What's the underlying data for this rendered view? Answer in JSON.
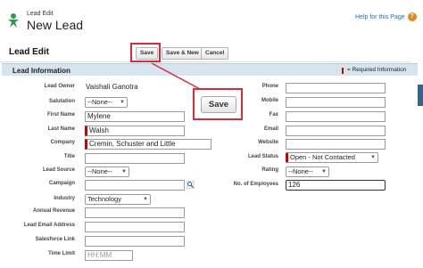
{
  "header": {
    "subtitle": "Lead Edit",
    "title": "New Lead",
    "help_link": "Help for this Page"
  },
  "edit_bar": {
    "title": "Lead Edit",
    "save": "Save",
    "save_new": "Save & New",
    "cancel": "Cancel"
  },
  "section": {
    "title": "Lead Information",
    "required_legend": "= Required Information"
  },
  "left_fields": {
    "lead_owner": {
      "label": "Lead Owner",
      "value": "Vaishali Ganotra"
    },
    "salutation": {
      "label": "Salutation",
      "value": "--None--"
    },
    "first_name": {
      "label": "First Name",
      "value": "Mylene"
    },
    "last_name": {
      "label": "Last Name",
      "value": "Walsh"
    },
    "company": {
      "label": "Company",
      "value": "Cremin, Schuster and Little"
    },
    "title": {
      "label": "Title",
      "value": ""
    },
    "lead_source": {
      "label": "Lead Source",
      "value": "--None--"
    },
    "campaign": {
      "label": "Campaign",
      "value": ""
    },
    "industry": {
      "label": "Industry",
      "value": "Technology"
    },
    "annual_revenue": {
      "label": "Annual Revenue",
      "value": ""
    },
    "lead_email_address": {
      "label": "Lead Email Address",
      "value": ""
    },
    "salesforce_link": {
      "label": "Salesforce Link",
      "value": ""
    },
    "time_limit": {
      "label": "Time Limit",
      "placeholder": "HH:MM"
    }
  },
  "right_fields": {
    "phone": {
      "label": "Phone",
      "value": ""
    },
    "mobile": {
      "label": "Mobile",
      "value": ""
    },
    "fax": {
      "label": "Fax",
      "value": ""
    },
    "email": {
      "label": "Email",
      "value": ""
    },
    "website": {
      "label": "Website",
      "value": ""
    },
    "lead_status": {
      "label": "Lead Status",
      "value": "Open - Not Contacted"
    },
    "rating": {
      "label": "Rating",
      "value": "--None--"
    },
    "no_of_employees": {
      "label": "No. of Employees",
      "value": "126"
    }
  },
  "callout": {
    "label": "Save"
  },
  "colors": {
    "highlight": "#d92a3c",
    "required": "#cc0000",
    "section_bg": "#d6e4ee",
    "link": "#1a6fb5"
  },
  "icons": [
    "lead-icon",
    "help-icon",
    "lookup-icon",
    "chevron-down-icon"
  ]
}
